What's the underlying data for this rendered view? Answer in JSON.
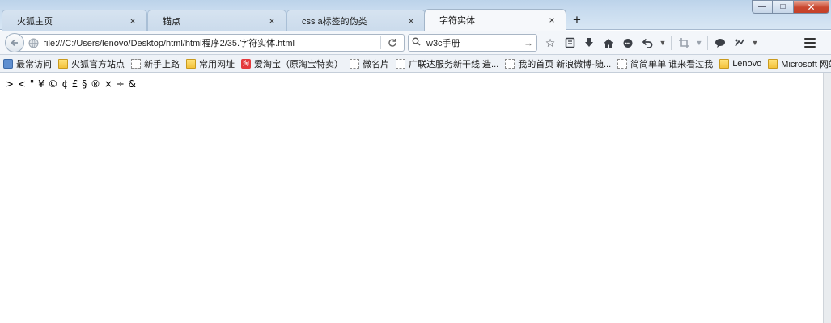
{
  "tabs": [
    {
      "label": "火狐主页",
      "active": false
    },
    {
      "label": "锚点",
      "active": false
    },
    {
      "label": "css a标签的伪类",
      "active": false
    },
    {
      "label": "字符实体",
      "active": true
    }
  ],
  "tab_close_glyph": "×",
  "new_tab_glyph": "+",
  "window_buttons": {
    "minimize": "—",
    "maximize": "□",
    "close": "✕"
  },
  "navbar": {
    "url": "file:///C:/Users/lenovo/Desktop/html/html程序2/35.字符实体.html",
    "search_value": "w3c手册"
  },
  "toolbar_icons": [
    "star-icon",
    "reading-list-icon",
    "download-icon",
    "home-icon",
    "chat-icon",
    "undo-icon",
    "crop-icon",
    "comment-icon",
    "screenshot-icon",
    "menu-icon"
  ],
  "bookmarks": [
    {
      "label": "最常访问",
      "icon": "history"
    },
    {
      "label": "火狐官方站点",
      "icon": "folder"
    },
    {
      "label": "新手上路",
      "icon": "page"
    },
    {
      "label": "常用网址",
      "icon": "folder"
    },
    {
      "label": "爱淘宝（原淘宝特卖）",
      "icon": "taobao"
    },
    {
      "label": "微名片",
      "icon": "page"
    },
    {
      "label": "广联达服务新干线 造...",
      "icon": "page"
    },
    {
      "label": "我的首页 新浪微博-随...",
      "icon": "page"
    },
    {
      "label": "简简单单 谁来看过我",
      "icon": "page"
    },
    {
      "label": "Lenovo",
      "icon": "folder"
    },
    {
      "label": "Microsoft 网站",
      "icon": "folder"
    }
  ],
  "bookmarks_overflow": "»",
  "page": {
    "entities_text": "> < \" ¥ © ¢ £ § ® × ÷ &"
  },
  "colors": {
    "tabstrip": "#c9dcef",
    "close_button": "#c64128",
    "folder": "#f3c23b"
  }
}
